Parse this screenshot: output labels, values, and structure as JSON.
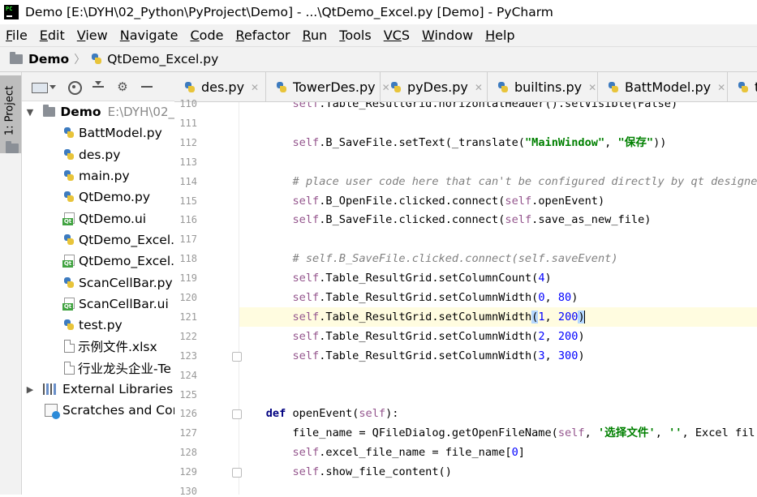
{
  "window": {
    "app_icon_text": "PC",
    "title": "Demo [E:\\DYH\\02_Python\\PyProject\\Demo] - ...\\QtDemo_Excel.py [Demo] - PyCharm"
  },
  "menu": [
    {
      "mnemonic": "F",
      "rest": "ile"
    },
    {
      "mnemonic": "E",
      "rest": "dit"
    },
    {
      "mnemonic": "V",
      "rest": "iew"
    },
    {
      "mnemonic": "N",
      "rest": "avigate"
    },
    {
      "mnemonic": "C",
      "rest": "ode"
    },
    {
      "mnemonic": "R",
      "rest": "efactor"
    },
    {
      "mnemonic": "R",
      "rest": "un"
    },
    {
      "mnemonic": "T",
      "rest": "ools"
    },
    {
      "mnemonic": "VC",
      "rest": "S"
    },
    {
      "mnemonic": "W",
      "rest": "indow"
    },
    {
      "mnemonic": "H",
      "rest": "elp"
    }
  ],
  "breadcrumb": {
    "project": "Demo",
    "separator": "〉",
    "file": "QtDemo_Excel.py"
  },
  "tool_strip": {
    "project_tab_label": "1: Project"
  },
  "project_panel": {
    "root": {
      "name": "Demo",
      "path": "E:\\DYH\\02_"
    },
    "files": [
      {
        "name": "BattModel.py",
        "icon": "python-file-icon"
      },
      {
        "name": "des.py",
        "icon": "python-file-icon"
      },
      {
        "name": "main.py",
        "icon": "python-file-icon"
      },
      {
        "name": "QtDemo.py",
        "icon": "python-file-icon"
      },
      {
        "name": "QtDemo.ui",
        "icon": "qt-ui-file-icon"
      },
      {
        "name": "QtDemo_Excel.",
        "icon": "python-file-icon"
      },
      {
        "name": "QtDemo_Excel.",
        "icon": "qt-ui-file-icon"
      },
      {
        "name": "ScanCellBar.py",
        "icon": "python-file-icon"
      },
      {
        "name": "ScanCellBar.ui",
        "icon": "qt-ui-file-icon"
      },
      {
        "name": "test.py",
        "icon": "python-file-icon"
      },
      {
        "name": "示例文件.xlsx",
        "icon": "xlsx-file-icon"
      },
      {
        "name": "行业龙头企业-Te",
        "icon": "xlsx-file-icon"
      }
    ],
    "external_libraries": "External Libraries",
    "scratches": "Scratches and Cons"
  },
  "tabs": [
    {
      "label": "des.py"
    },
    {
      "label": "TowerDes.py"
    },
    {
      "label": "pyDes.py"
    },
    {
      "label": "builtins.py"
    },
    {
      "label": "BattModel.py"
    },
    {
      "label": "t"
    }
  ],
  "editor": {
    "current_line": "121",
    "lines": [
      {
        "n": "110",
        "t": "        self.Table_ResultGrid.horizontalHeader().setVisible(False)"
      },
      {
        "n": "111",
        "t": ""
      },
      {
        "n": "112",
        "t": "        self.B_SaveFile.setText(_translate(\"MainWindow\", \"保存\"))"
      },
      {
        "n": "113",
        "t": ""
      },
      {
        "n": "114",
        "t": "        # place user code here that can't be configured directly by qt designer"
      },
      {
        "n": "115",
        "t": "        self.B_OpenFile.clicked.connect(self.openEvent)"
      },
      {
        "n": "116",
        "t": "        self.B_SaveFile.clicked.connect(self.save_as_new_file)"
      },
      {
        "n": "117",
        "t": ""
      },
      {
        "n": "118",
        "t": "        # self.B_SaveFile.clicked.connect(self.saveEvent)"
      },
      {
        "n": "119",
        "t": "        self.Table_ResultGrid.setColumnCount(4)"
      },
      {
        "n": "120",
        "t": "        self.Table_ResultGrid.setColumnWidth(0, 80)"
      },
      {
        "n": "121",
        "t": "        self.Table_ResultGrid.setColumnWidth(1, 200)"
      },
      {
        "n": "122",
        "t": "        self.Table_ResultGrid.setColumnWidth(2, 200)"
      },
      {
        "n": "123",
        "t": "        self.Table_ResultGrid.setColumnWidth(3, 300)"
      },
      {
        "n": "124",
        "t": ""
      },
      {
        "n": "125",
        "t": ""
      },
      {
        "n": "126",
        "t": "    def openEvent(self):"
      },
      {
        "n": "127",
        "t": "        file_name = QFileDialog.getOpenFileName(self, '选择文件', '', 'Excel fil"
      },
      {
        "n": "128",
        "t": "        self.excel_file_name = file_name[0]"
      },
      {
        "n": "129",
        "t": "        self.show_file_content()"
      },
      {
        "n": "130",
        "t": ""
      }
    ]
  },
  "colors": {
    "keyword": "#000080",
    "self": "#94558d",
    "string": "#008000",
    "comment": "#808080",
    "number": "#0000ff",
    "current_line_bg": "#fffce0"
  }
}
